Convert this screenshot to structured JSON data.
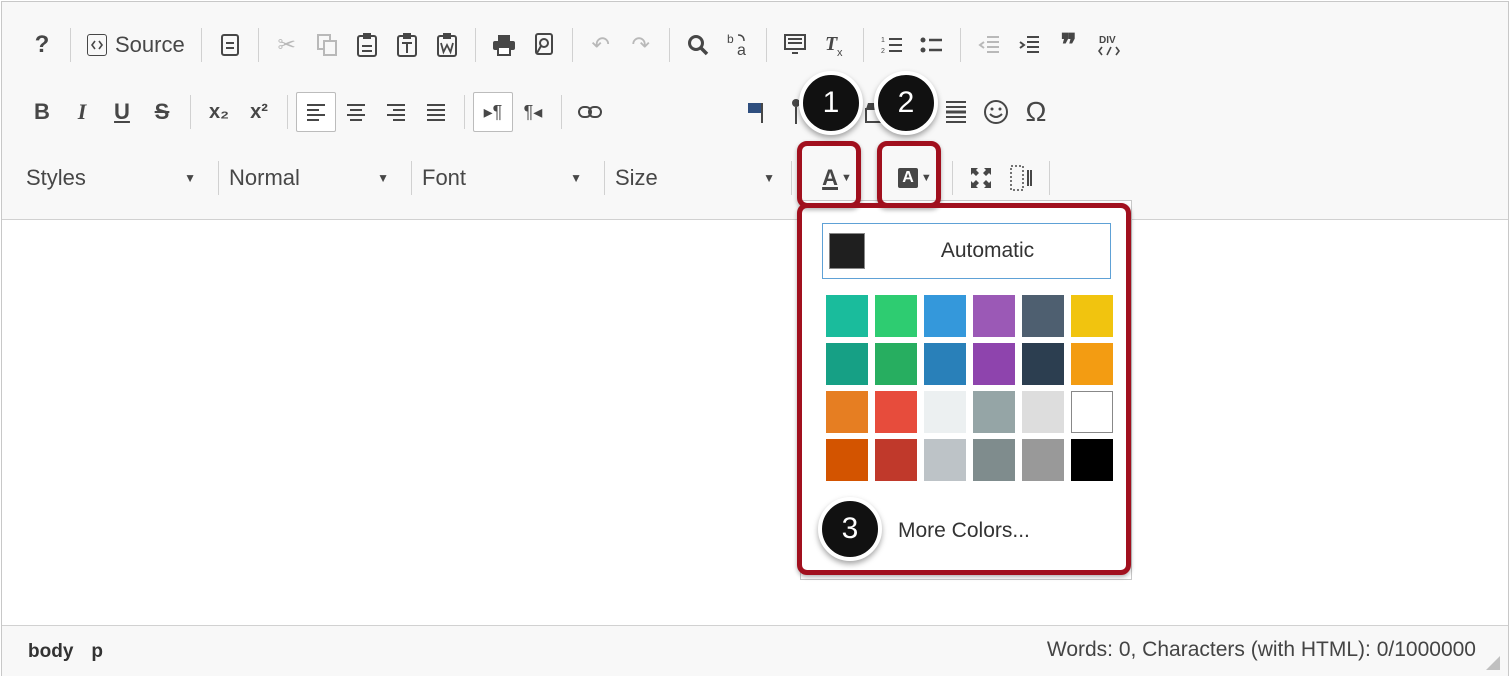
{
  "toolbar": {
    "row1": {
      "help": "?",
      "source": "Source",
      "source_icon": "source-icon"
    },
    "row2": {
      "bold": "B",
      "italic": "I",
      "underline": "U",
      "strike": "S",
      "subscript": "x₂",
      "superscript": "x²",
      "omega": "Ω"
    },
    "row3": {
      "styles": "Styles",
      "format": "Normal",
      "font": "Font",
      "size": "Size",
      "text_color_letter": "A",
      "bg_color_letter": "A"
    }
  },
  "annotations": {
    "badge1": "1",
    "badge2": "2",
    "badge3": "3",
    "highlight_color": "#a1101e"
  },
  "color_panel": {
    "automatic_label": "Automatic",
    "automatic_color": "#1f1f1f",
    "more_colors": "More Colors...",
    "swatches": [
      "#1abc9c",
      "#2ecc71",
      "#3498db",
      "#9b59b6",
      "#4e5f70",
      "#f1c40f",
      "#16a085",
      "#27ae60",
      "#2980b9",
      "#8e44ad",
      "#2c3e50",
      "#f39c12",
      "#e67e22",
      "#e74c3c",
      "#ecf0f1",
      "#95a5a6",
      "#dddddd",
      "#ffffff",
      "#d35400",
      "#c0392b",
      "#bdc3c7",
      "#7f8c8d",
      "#999999",
      "#000000"
    ]
  },
  "statusbar": {
    "path": [
      "body",
      "p"
    ],
    "counter": "Words: 0, Characters (with HTML): 0/1000000"
  }
}
